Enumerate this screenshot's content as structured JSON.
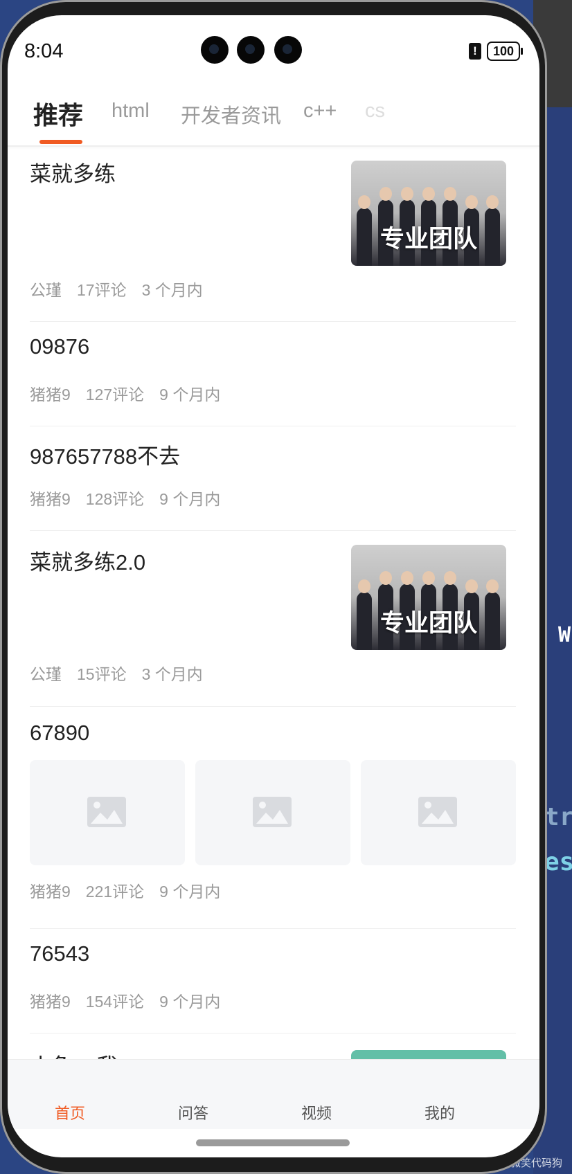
{
  "status": {
    "time": "8:04",
    "alert": "!",
    "battery": "100"
  },
  "tabs": [
    {
      "label": "推荐",
      "active": true
    },
    {
      "label": "html",
      "active": false
    },
    {
      "label": "开发者资讯",
      "active": false
    },
    {
      "label": "c++",
      "active": false
    },
    {
      "label": "cs",
      "active": false
    }
  ],
  "articles": [
    {
      "title": "菜就多练",
      "author": "公瑾",
      "comments": "17评论",
      "time": "3 个月内",
      "thumb_text": "专业团队"
    },
    {
      "title": "09876",
      "author": "猪猪9",
      "comments": "127评论",
      "time": "9 个月内"
    },
    {
      "title": "987657788不去",
      "author": "猪猪9",
      "comments": "128评论",
      "time": "9 个月内"
    },
    {
      "title": "菜就多练2.0",
      "author": "公瑾",
      "comments": "15评论",
      "time": "3 个月内",
      "thumb_text": "专业团队"
    },
    {
      "title": "67890",
      "author": "猪猪9",
      "comments": "221评论",
      "time": "9 个月内",
      "placeholder_icon": "image-placeholder-icon"
    },
    {
      "title": "76543",
      "author": "猪猪9",
      "comments": "154评论",
      "time": "9 个月内"
    },
    {
      "title": "小兔... 我"
    }
  ],
  "bottom_nav": [
    {
      "label": "首页",
      "active": true
    },
    {
      "label": "问答",
      "active": false
    },
    {
      "label": "视频",
      "active": false
    },
    {
      "label": "我的",
      "active": false
    }
  ],
  "colors": {
    "accent": "#f05a22",
    "text": "#222222",
    "meta": "#9a9a9a",
    "background_editor": "#2a3f7a"
  },
  "background": {
    "code_w": "W",
    "code_tr": "tr",
    "code_es": "es",
    "watermark": "CSDN @@逆风微笑代码狗"
  }
}
